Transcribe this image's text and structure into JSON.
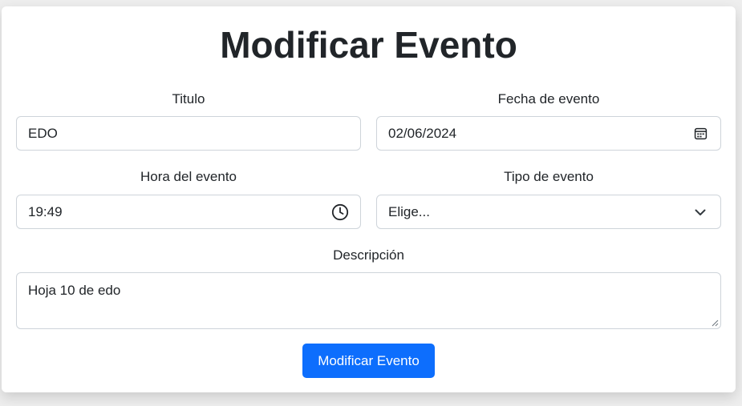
{
  "form": {
    "heading": "Modificar Evento",
    "titulo": {
      "label": "Titulo",
      "value": "EDO"
    },
    "fecha": {
      "label": "Fecha de evento",
      "value": "02/06/2024",
      "icon": "calendar-icon"
    },
    "hora": {
      "label": "Hora del evento",
      "value": "19:49",
      "icon": "clock-icon"
    },
    "tipo": {
      "label": "Tipo de evento",
      "selected": "Elige...",
      "icon": "chevron-down-icon"
    },
    "descripcion": {
      "label": "Descripción",
      "value": "Hoja 10 de edo"
    },
    "submit_label": "Modificar Evento"
  },
  "colors": {
    "primary": "#0d6efd",
    "text": "#212529",
    "border": "#ced4da",
    "background": "#eeeeee"
  }
}
